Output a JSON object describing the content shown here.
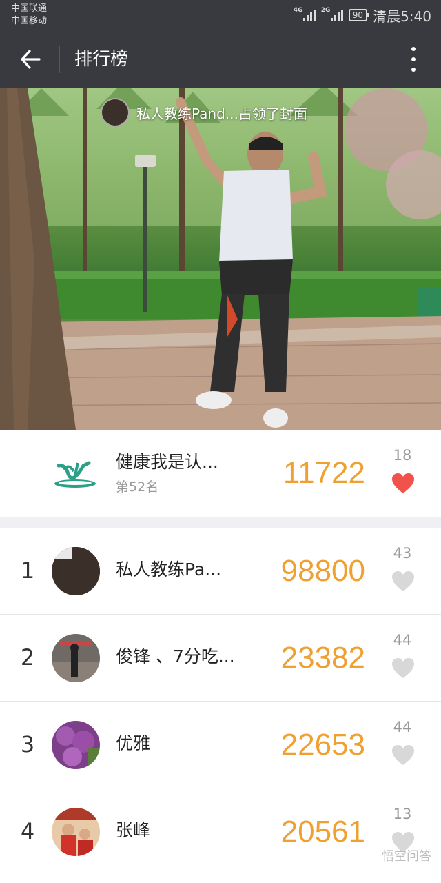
{
  "status_bar": {
    "carrier1": "中国联通",
    "carrier2": "中国移动",
    "net1": "4G",
    "net2": "2G",
    "battery": "90",
    "time": "清晨5:40"
  },
  "header": {
    "title": "排行榜"
  },
  "cover": {
    "caption": "私人教练Pand...占领了封面"
  },
  "my_rank": {
    "name": "健康我是认...",
    "rank_text": "第52名",
    "score": "11722",
    "likes": "18",
    "liked": true
  },
  "ranking": [
    {
      "rank": "1",
      "name": "私人教练Pa...",
      "score": "98800",
      "likes": "43"
    },
    {
      "rank": "2",
      "name": "俊锋 、7分吃...",
      "score": "23382",
      "likes": "44"
    },
    {
      "rank": "3",
      "name": "优雅",
      "score": "22653",
      "likes": "44"
    },
    {
      "rank": "4",
      "name": "张峰",
      "score": "20561",
      "likes": "13"
    }
  ],
  "watermark": "悟空问答",
  "colors": {
    "bar_bg": "#393a3f",
    "score": "#f0a030",
    "heart_active": "#f2524c",
    "heart_inactive": "#d8d8d8"
  }
}
